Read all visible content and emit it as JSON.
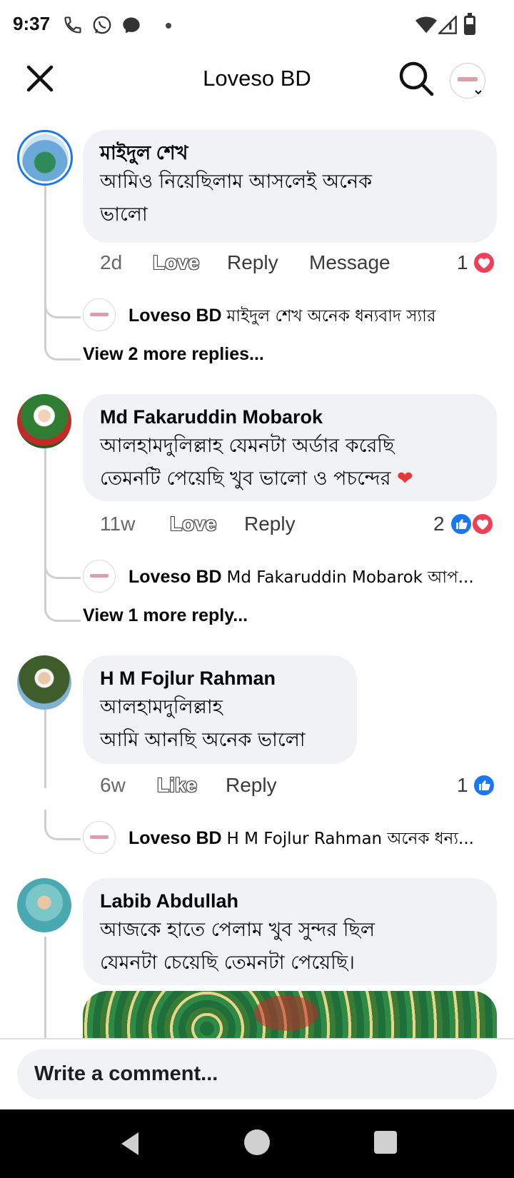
{
  "status_bar": {
    "time": "9:37"
  },
  "header": {
    "title": "Loveso BD"
  },
  "comments": [
    {
      "author": "মাইদুল শেখ",
      "text_lines": [
        "আমিও নিয়েছিলাম আসলেই অনেক",
        "ভালো"
      ],
      "time": "2d",
      "react_label": "Love",
      "reply_label": "Reply",
      "message_label": "Message",
      "reaction_count": "1",
      "reply": {
        "name": "Loveso BD",
        "text": "মাইদুল শেখ অনেক ধন্যবাদ স্যার"
      },
      "view_more": "View 2 more replies..."
    },
    {
      "author": "Md Fakaruddin Mobarok",
      "text_lines": [
        "আলহামদুলিল্লাহ যেমনটা অর্ডার করেছি",
        "তেমনটি পেয়েছি খুব ভালো ও পচন্দের"
      ],
      "time": "11w",
      "react_label": "Love",
      "reply_label": "Reply",
      "reaction_count": "2",
      "reply": {
        "name": "Loveso BD",
        "text": "Md Fakaruddin Mobarok আপ..."
      },
      "view_more": "View 1 more reply..."
    },
    {
      "author": "H M Fojlur Rahman",
      "text_lines": [
        "আলহামদুলিল্লাহ",
        "আমি আনছি অনেক ভালো"
      ],
      "time": "6w",
      "react_label": "Like",
      "reply_label": "Reply",
      "reaction_count": "1",
      "reply": {
        "name": "Loveso BD",
        "text": "H M Fojlur Rahman অনেক ধন্য..."
      }
    },
    {
      "author": "Labib Abdullah",
      "text_lines": [
        "আজকে হাতে পেলাম খুব সুন্দর ছিল",
        "যেমনটা চেয়েছি তেমনটা পেয়েছি।"
      ]
    }
  ],
  "composer": {
    "placeholder": "Write a comment..."
  },
  "colors": {
    "like_blue": "#1877f2",
    "love_red": "#f33e58",
    "bubble_gray": "#f0f2f5",
    "meta_gray": "#65676b"
  },
  "icons": [
    "close-icon",
    "search-icon",
    "like-reaction-icon",
    "love-reaction-icon",
    "back-nav-icon",
    "home-nav-icon",
    "recents-nav-icon"
  ]
}
